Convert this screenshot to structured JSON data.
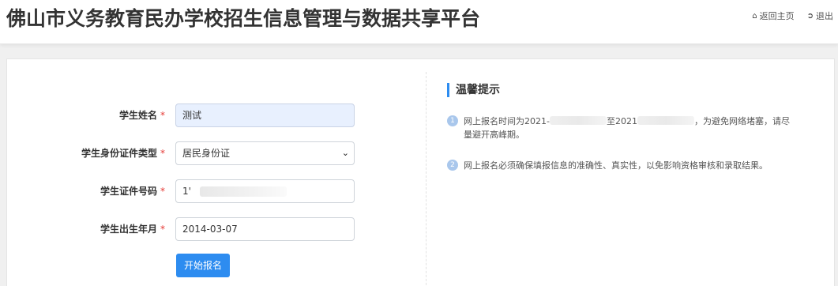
{
  "header": {
    "title": "佛山市义务教育民办学校招生信息管理与数据共享平台",
    "links": [
      {
        "icon": "home-icon",
        "label": "返回主页"
      },
      {
        "icon": "logout-icon",
        "label": "退出"
      }
    ]
  },
  "form": {
    "fields": [
      {
        "label": "学生姓名",
        "required_mark": "*",
        "value": "测试"
      },
      {
        "label": "学生身份证件类型",
        "required_mark": "*",
        "value": "居民身份证",
        "type": "select"
      },
      {
        "label": "学生证件号码",
        "required_mark": "*",
        "value": "1'"
      },
      {
        "label": "学生出生年月",
        "required_mark": "*",
        "value": "2014-03-07"
      }
    ],
    "submit_label": "开始报名"
  },
  "tips": {
    "title": "温馨提示",
    "items": [
      {
        "num": "1",
        "part1": "网上报名时间为2021-",
        "part2": "至2021",
        "part3": "，为避免网络堵塞，请尽量避开高峰期。"
      },
      {
        "num": "2",
        "text": "网上报名必须确保填报信息的准确性、真实性，以免影响资格审核和录取结果。"
      }
    ]
  },
  "colors": {
    "accent": "#2d8cf0",
    "required": "#e53935",
    "autofill": "#e8f0fe"
  }
}
